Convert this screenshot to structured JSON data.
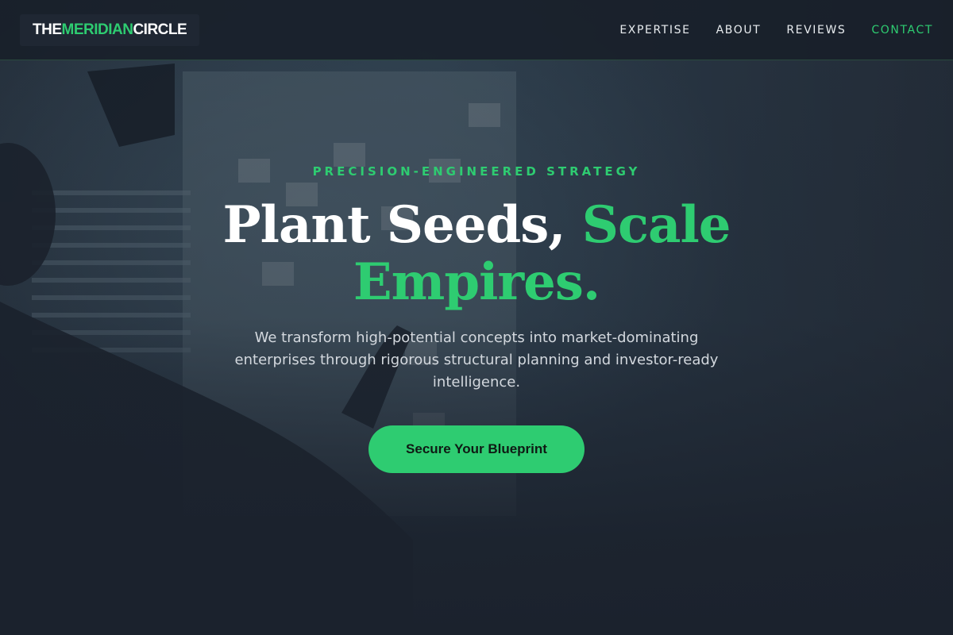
{
  "brand": {
    "name_part1": "THE ",
    "name_accent": "MERIDIAN",
    "name_part2": " CIRCLE"
  },
  "nav": {
    "items": [
      {
        "label": "EXPERTISE"
      },
      {
        "label": "ABOUT"
      },
      {
        "label": "REVIEWS"
      },
      {
        "label": "CONTACT"
      }
    ]
  },
  "hero": {
    "eyebrow": "PRECISION-ENGINEERED STRATEGY",
    "headline_plain": "Plant Seeds, ",
    "headline_accent": "Scale Empires.",
    "subtext": "We transform high-potential concepts into market-dominating enterprises through rigorous structural planning and investor-ready intelligence.",
    "cta_label": "Secure Your Blueprint"
  },
  "colors": {
    "accent": "#2ecc71",
    "background": "#1b222d",
    "text": "#ffffff"
  }
}
